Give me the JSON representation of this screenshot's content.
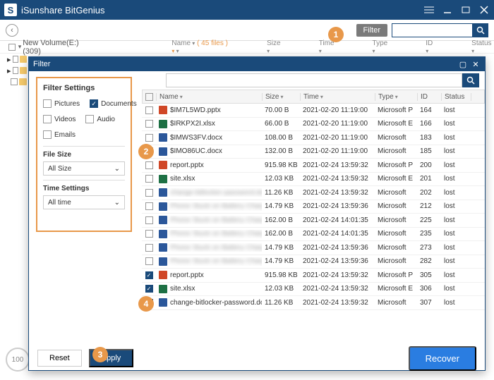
{
  "app": {
    "title": "iSunshare BitGenius"
  },
  "toolbar": {
    "filter_label": "Filter"
  },
  "tree": {
    "volume": "New Volume(E:)(309)"
  },
  "headers": {
    "name": "Name",
    "name_count": "( 45 files )",
    "size": "Size",
    "time": "Time",
    "type": "Type",
    "id": "ID",
    "status": "Status"
  },
  "filter": {
    "dialog_title": "Filter",
    "settings_title": "Filter Settings",
    "options": {
      "pictures": "Pictures",
      "documents": "Documents",
      "videos": "Videos",
      "audio": "Audio",
      "emails": "Emails"
    },
    "file_size_label": "File Size",
    "file_size_value": "All Size",
    "time_label": "Time Settings",
    "time_value": "All time",
    "reset": "Reset",
    "apply": "Apply",
    "recover": "Recover"
  },
  "files": [
    {
      "checked": false,
      "icon": "pptx",
      "name": "$IM7L5WD.pptx",
      "blur": false,
      "size": "70.00 B",
      "time": "2021-02-20 11:19:00",
      "type": "Microsoft P",
      "id": "164",
      "status": "lost"
    },
    {
      "checked": false,
      "icon": "xlsx",
      "name": "$IRKPX2I.xlsx",
      "blur": false,
      "size": "66.00 B",
      "time": "2021-02-20 11:19:00",
      "type": "Microsoft E",
      "id": "166",
      "status": "lost"
    },
    {
      "checked": false,
      "icon": "docx",
      "name": "$IMWS3FV.docx",
      "blur": false,
      "size": "108.00 B",
      "time": "2021-02-20 11:19:00",
      "type": "Microsoft",
      "id": "183",
      "status": "lost"
    },
    {
      "checked": false,
      "icon": "docx",
      "name": "$IMO86UC.docx",
      "blur": false,
      "size": "132.00 B",
      "time": "2021-02-20 11:19:00",
      "type": "Microsoft",
      "id": "185",
      "status": "lost"
    },
    {
      "checked": false,
      "icon": "pptx",
      "name": "report.pptx",
      "blur": false,
      "size": "915.98 KB",
      "time": "2021-02-24 13:59:32",
      "type": "Microsoft P",
      "id": "200",
      "status": "lost"
    },
    {
      "checked": false,
      "icon": "xlsx",
      "name": "site.xlsx",
      "blur": false,
      "size": "12.03 KB",
      "time": "2021-02-24 13:59:32",
      "type": "Microsoft E",
      "id": "201",
      "status": "lost"
    },
    {
      "checked": false,
      "icon": "docx",
      "name": "change-bitlocker-password.docx",
      "blur": true,
      "size": "11.26 KB",
      "time": "2021-02-24 13:59:32",
      "type": "Microsoft",
      "id": "202",
      "status": "lost"
    },
    {
      "checked": false,
      "icon": "docx",
      "name": "Phone Stuck on Battery Charging Log",
      "blur": true,
      "size": "14.79 KB",
      "time": "2021-02-24 13:59:36",
      "type": "Microsoft",
      "id": "212",
      "status": "lost"
    },
    {
      "checked": false,
      "icon": "docx",
      "name": "Phone Stuck on Battery Charging Log",
      "blur": true,
      "size": "162.00 B",
      "time": "2021-02-24 14:01:35",
      "type": "Microsoft",
      "id": "225",
      "status": "lost"
    },
    {
      "checked": false,
      "icon": "docx",
      "name": "Phone Stuck on Battery Charging Log",
      "blur": true,
      "size": "162.00 B",
      "time": "2021-02-24 14:01:35",
      "type": "Microsoft",
      "id": "235",
      "status": "lost"
    },
    {
      "checked": false,
      "icon": "docx",
      "name": "Phone Stuck on Battery Charging Log",
      "blur": true,
      "size": "14.79 KB",
      "time": "2021-02-24 13:59:36",
      "type": "Microsoft",
      "id": "273",
      "status": "lost"
    },
    {
      "checked": false,
      "icon": "docx",
      "name": "Phone Stuck on Battery Charging Log",
      "blur": true,
      "size": "14.79 KB",
      "time": "2021-02-24 13:59:36",
      "type": "Microsoft",
      "id": "282",
      "status": "lost"
    },
    {
      "checked": true,
      "icon": "pptx",
      "name": "report.pptx",
      "blur": false,
      "size": "915.98 KB",
      "time": "2021-02-24 13:59:32",
      "type": "Microsoft P",
      "id": "305",
      "status": "lost"
    },
    {
      "checked": true,
      "icon": "xlsx",
      "name": "site.xlsx",
      "blur": false,
      "size": "12.03 KB",
      "time": "2021-02-24 13:59:32",
      "type": "Microsoft E",
      "id": "306",
      "status": "lost"
    },
    {
      "checked": true,
      "icon": "docx",
      "name": "change-bitlocker-password.docx",
      "blur": false,
      "size": "11.26 KB",
      "time": "2021-02-24 13:59:32",
      "type": "Microsoft",
      "id": "307",
      "status": "lost"
    }
  ],
  "callouts": {
    "c1": "1",
    "c2": "2",
    "c3": "3",
    "c4": "4"
  },
  "progress": "100"
}
